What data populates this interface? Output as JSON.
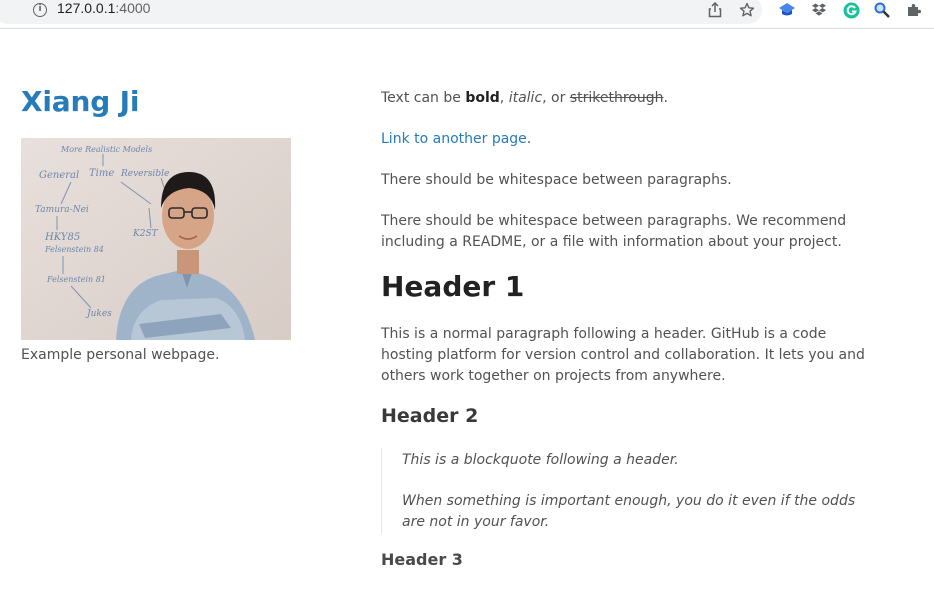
{
  "browser": {
    "url_host": "127.0.0.1",
    "url_port": ":4000",
    "info_icon": "i"
  },
  "sidebar": {
    "title": "Xiang Ji",
    "caption": "Example personal webpage.",
    "photo_board_text": [
      "More Realistic Models",
      "General",
      "Time",
      "Reversible",
      "Tamura-Nei",
      "HKY85",
      "Felsenstein 84",
      "Felsenstein 81",
      "Jukes",
      "K2ST"
    ]
  },
  "content": {
    "p1": {
      "prefix": "Text can be ",
      "bold": "bold",
      "sep1": ", ",
      "italic": "italic",
      "sep2": ", or ",
      "strike": "strikethrough",
      "suffix": "."
    },
    "p2": {
      "link": "Link to another page",
      "suffix": "."
    },
    "p3": "There should be whitespace between paragraphs.",
    "p4": "There should be whitespace between paragraphs. We recommend including a README, or a file with information about your project.",
    "h1": "Header 1",
    "p5": "This is a normal paragraph following a header. GitHub is a code hosting platform for version control and collaboration. It lets you and others work together on projects from anywhere.",
    "h2": "Header 2",
    "quote1": "This is a blockquote following a header.",
    "quote2": "When something is important enough, you do it even if the odds are not in your favor.",
    "h3": "Header 3"
  },
  "colors": {
    "link": "#267CB9",
    "text": "#525252",
    "heading": "#222222"
  }
}
